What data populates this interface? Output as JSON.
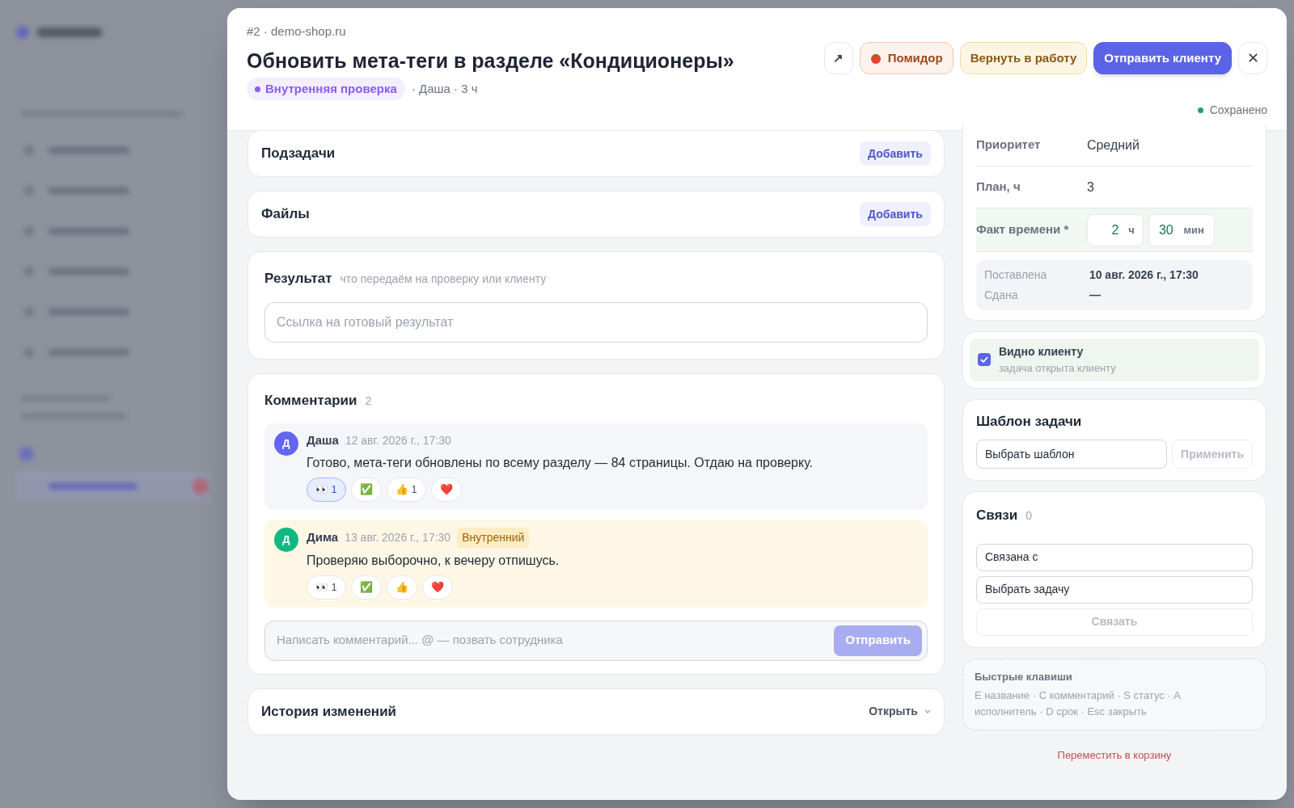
{
  "header": {
    "breadcrumb": "#2 · demo-shop.ru",
    "title": "Обновить мета-теги в разделе «Кондиционеры»",
    "status": {
      "label": "Внутренняя проверка",
      "color": "#8b5cf6"
    },
    "meta": "· Даша · 3 ч",
    "actions": [
      {
        "kind": "icon",
        "label": "↗"
      },
      {
        "kind": "tomato",
        "label": "Помидор"
      },
      {
        "kind": "warning",
        "label": "Вернуть в работу"
      },
      {
        "kind": "primary",
        "label": "Отправить клиенту"
      },
      {
        "kind": "close",
        "label": "✕"
      }
    ],
    "saved": "Сохранено"
  },
  "subtasks": {
    "title": "Подзадачи",
    "button": "Добавить"
  },
  "files": {
    "title": "Файлы",
    "button": "Добавить"
  },
  "result": {
    "title": "Результат",
    "hint": "что передаём на проверку или клиенту",
    "placeholder": "Ссылка на готовый результат"
  },
  "comments": {
    "title": "Комментарии",
    "count": "2",
    "items": [
      {
        "kind": "public",
        "avatar": "Д",
        "color": "#6366f1",
        "author": "Даша",
        "date": "12 авг. 2026 г., 17:30",
        "text": "Готово, мета-теги обновлены по всему разделу — 84 страницы. Отдаю на проверку.",
        "reactions": [
          {
            "emoji": "👀",
            "count": "1",
            "selected": true
          },
          {
            "emoji": "✅",
            "selected": false
          },
          {
            "emoji": "👍",
            "count": "1",
            "selected": false
          },
          {
            "emoji": "❤️",
            "selected": false
          }
        ]
      },
      {
        "kind": "internal",
        "avatar": "Д",
        "color": "#10b981",
        "author": "Дима",
        "date": "13 авг. 2026 г., 17:30",
        "badge": "Внутренний",
        "text": "Проверяю выборочно, к вечеру отпишусь.",
        "reactions": [
          {
            "emoji": "👀",
            "count": "1",
            "selected": false
          },
          {
            "emoji": "✅",
            "selected": false
          },
          {
            "emoji": "👍",
            "selected": false
          },
          {
            "emoji": "❤️",
            "selected": false
          }
        ]
      }
    ],
    "input_placeholder": "Написать комментарий... @ — позвать сотрудника",
    "send": "Отправить"
  },
  "history": {
    "title": "История изменений",
    "button": "Открыть"
  },
  "properties": [
    {
      "label": "Приоритет",
      "value": "Средний"
    },
    {
      "label": "План, ч",
      "value": "3"
    }
  ],
  "fact_time": {
    "label": "Факт времени *",
    "hours": "2",
    "hours_unit": "ч",
    "minutes": "30",
    "minutes_unit": "мин"
  },
  "dates": [
    {
      "label": "Поставлена",
      "value": "10 авг. 2026 г., 17:30"
    },
    {
      "label": "Сдана",
      "value": "—"
    }
  ],
  "visibility": {
    "checked": true,
    "title": "Видно клиенту",
    "subtitle": "задача открыта клиенту"
  },
  "template": {
    "title": "Шаблон задачи",
    "select": "Выбрать шаблон",
    "button": "Применить"
  },
  "links": {
    "title": "Связи",
    "count": "0",
    "type": "Связана с",
    "task": "Выбрать задачу",
    "button": "Связать"
  },
  "shortcuts": {
    "title": "Быстрые клавиши",
    "text": "E название · C комментарий · S статус · A исполнитель · D срок · Esc закрыть"
  },
  "trash": "Переместить в корзину"
}
